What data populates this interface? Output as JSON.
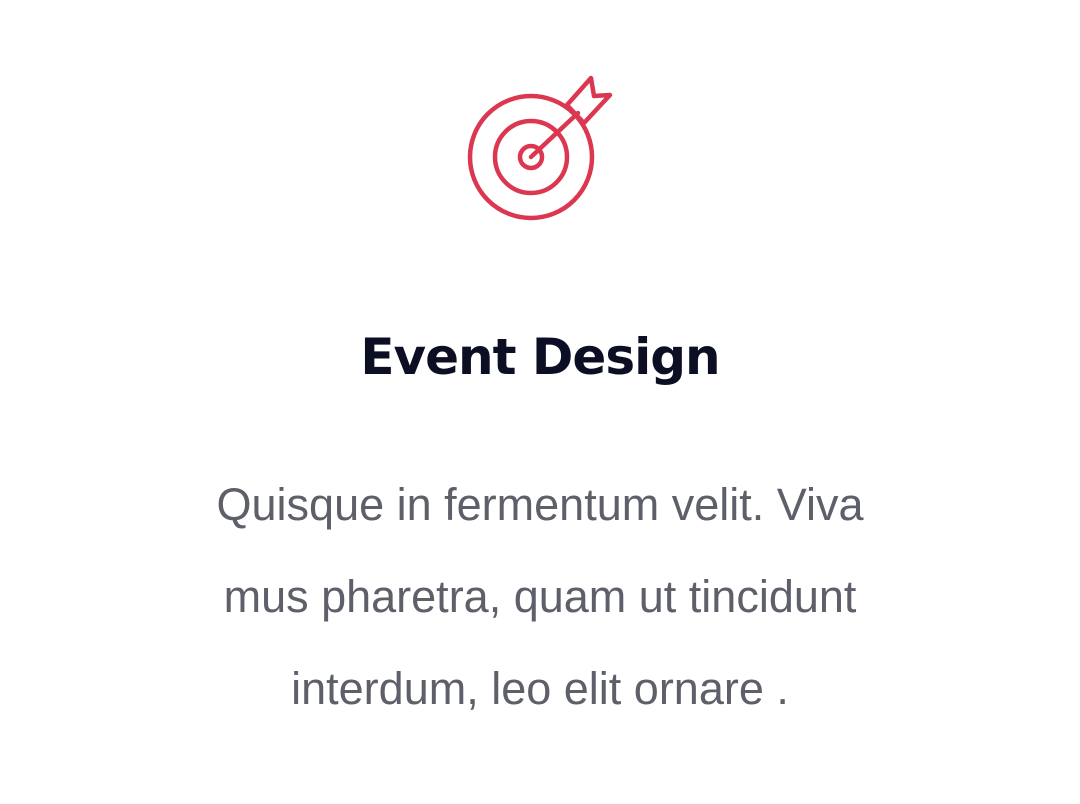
{
  "icon": {
    "name": "target-icon",
    "color": "#dc3750"
  },
  "feature": {
    "title": "Event Design",
    "description_lines": [
      "Quisque in fermentum velit. Viva",
      "mus pharetra, quam ut tincidunt",
      "interdum, leo elit ornare ."
    ]
  },
  "colors": {
    "background": "#ffffff",
    "title": "#0c0f24",
    "text": "#5d5f69"
  }
}
